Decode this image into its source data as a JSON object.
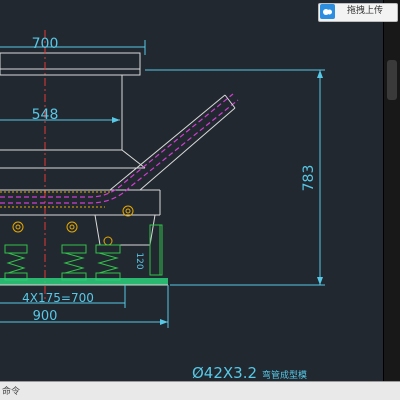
{
  "toolbar": {
    "upload_label": "拖拽上传",
    "upload_icon": "cloud-upload-icon"
  },
  "drawing": {
    "dim_top_width": "700",
    "dim_mid_width": "548",
    "dim_height": "783",
    "dim_spring_pitch": "4X175=700",
    "dim_base_width": "900",
    "dim_spring_height": "120",
    "title_spec": "Ø42X3.2",
    "title_desc": "弯管成型模"
  },
  "command_line": {
    "prompt": "命令"
  },
  "colors": {
    "background": "#212830",
    "dimension": "#57c8e6",
    "structure": "#d9d9d9",
    "centerline": "#e53935",
    "pipe": "#d13dd1",
    "spring": "#31c24a",
    "base": "#2bd07a"
  }
}
